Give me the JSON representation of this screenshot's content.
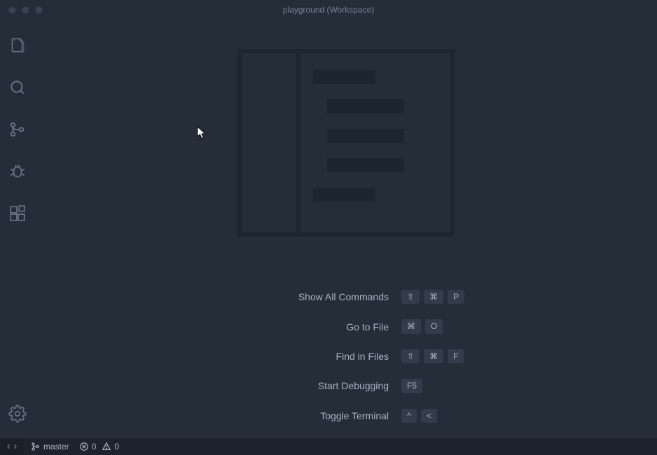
{
  "window": {
    "title": "playground (Workspace)"
  },
  "shortcuts": [
    {
      "label": "Show All Commands",
      "keys": [
        "⇧",
        "⌘",
        "P"
      ]
    },
    {
      "label": "Go to File",
      "keys": [
        "⌘",
        "O"
      ]
    },
    {
      "label": "Find in Files",
      "keys": [
        "⇧",
        "⌘",
        "F"
      ]
    },
    {
      "label": "Start Debugging",
      "keys": [
        "F5"
      ]
    },
    {
      "label": "Toggle Terminal",
      "keys": [
        "^",
        "<"
      ]
    }
  ],
  "statusbar": {
    "branch": "master",
    "errors": "0",
    "warnings": "0"
  }
}
